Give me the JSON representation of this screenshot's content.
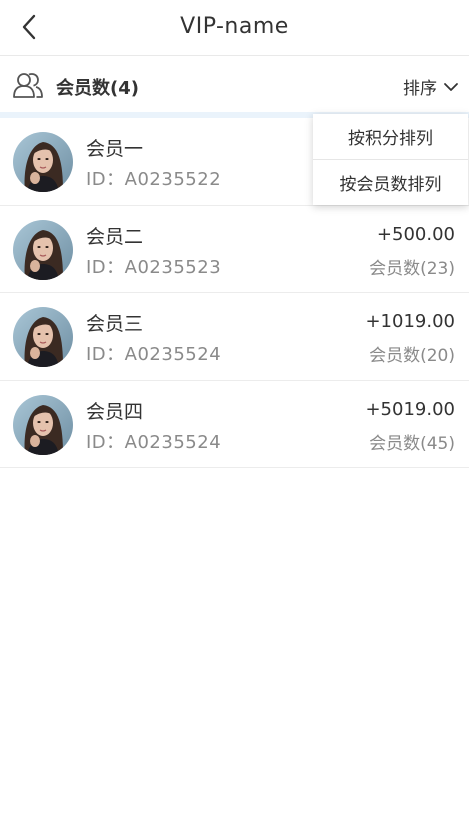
{
  "header": {
    "title": "VIP-name",
    "back_icon": "chevron-left-icon"
  },
  "summary": {
    "icon": "users-group-icon",
    "count_label": "会员数(4)",
    "sort_label": "排序",
    "sort_icon": "chevron-down-icon"
  },
  "sort_menu": {
    "options": [
      "按积分排列",
      "按会员数排列"
    ]
  },
  "members": [
    {
      "name": "会员一",
      "id": "ID：A0235522",
      "points": "",
      "members": ""
    },
    {
      "name": "会员二",
      "id": "ID：A0235523",
      "points": "+500.00",
      "members": "会员数(23)"
    },
    {
      "name": "会员三",
      "id": "ID：A0235524",
      "points": "+1019.00",
      "members": "会员数(20)"
    },
    {
      "name": "会员四",
      "id": "ID：A0235524",
      "points": "+5019.00",
      "members": "会员数(45)"
    }
  ],
  "colors": {
    "accent_band": "#eaf3fb",
    "text": "#333333",
    "muted": "#8a8a8a"
  }
}
